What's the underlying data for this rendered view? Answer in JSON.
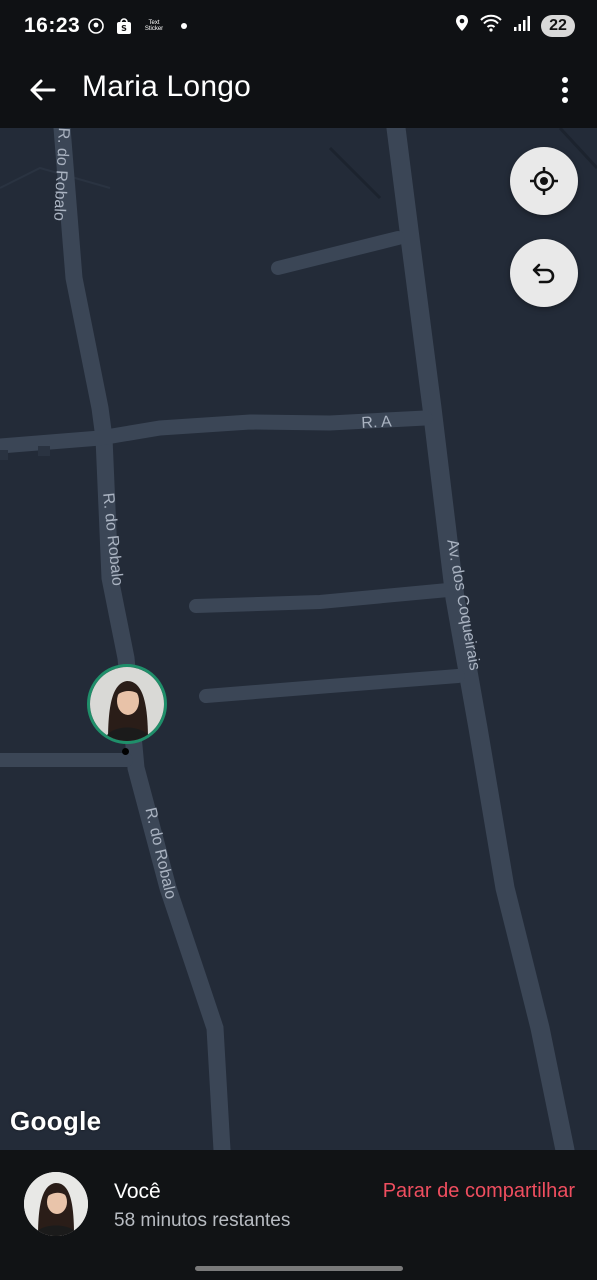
{
  "status_bar": {
    "time": "16:23",
    "left_icons": [
      "location-alert-icon",
      "shopping-bag-icon",
      "text-sticker-icon",
      "notification-dot-icon"
    ],
    "text_sticker_label": "Text Sticker",
    "right_icons": [
      "location-icon",
      "wifi-icon",
      "signal-icon"
    ],
    "battery": "22"
  },
  "app_bar": {
    "title": "Maria Longo",
    "back_icon": "arrow-left-icon",
    "overflow_icon": "more-vertical-icon"
  },
  "map": {
    "streets": {
      "rua_robalo_top": "R. do Robalo",
      "rua_robalo_mid": "R. do Robalo",
      "rua_robalo_bottom": "R. do Robalo",
      "rua_a": "R. A",
      "av_coqueirais": "Av. dos Coqueirais"
    },
    "logo": "Google",
    "buttons": {
      "recenter_icon": "my-location-icon",
      "undo_icon": "undo-icon"
    }
  },
  "bottom_sheet": {
    "name": "Você",
    "remaining": "58 minutos restantes",
    "stop_label": "Parar de compartilhar"
  },
  "colors": {
    "map_bg": "#232b38",
    "road": "#3b4656",
    "marker_ring": "#1f8f6a",
    "stop_red": "#ef4e5f"
  }
}
